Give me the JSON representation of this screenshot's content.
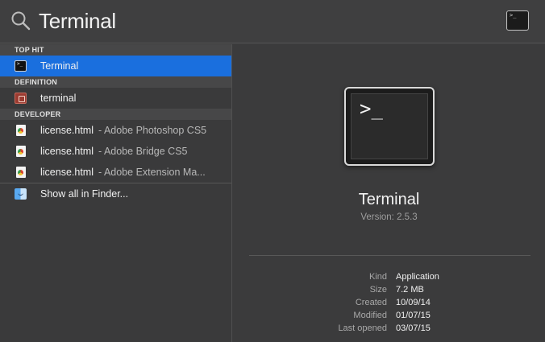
{
  "search": {
    "query": "Terminal"
  },
  "sections": {
    "top_hit": "TOP HIT",
    "definition": "DEFINITION",
    "developer": "DEVELOPER"
  },
  "results": {
    "top_hit": {
      "name": "Terminal",
      "icon": "terminal-icon"
    },
    "definition": {
      "name": "terminal",
      "icon": "dictionary-icon"
    },
    "developer": [
      {
        "name": "license.html",
        "sub": "- Adobe Photoshop CS5",
        "icon": "html-document-icon"
      },
      {
        "name": "license.html",
        "sub": "- Adobe Bridge CS5",
        "icon": "html-document-icon"
      },
      {
        "name": "license.html",
        "sub": "- Adobe Extension Ma...",
        "icon": "html-document-icon"
      }
    ],
    "show_all": {
      "name": "Show all in Finder...",
      "icon": "finder-icon"
    }
  },
  "preview": {
    "app_name": "Terminal",
    "version": "Version: 2.5.3",
    "prompt": ">_",
    "info": [
      {
        "key": "Kind",
        "value": "Application"
      },
      {
        "key": "Size",
        "value": "7.2 MB"
      },
      {
        "key": "Created",
        "value": "10/09/14"
      },
      {
        "key": "Modified",
        "value": "01/07/15"
      },
      {
        "key": "Last opened",
        "value": "03/07/15"
      }
    ]
  },
  "colors": {
    "selection": "#1a6fde",
    "background": "#3b3b3c"
  }
}
